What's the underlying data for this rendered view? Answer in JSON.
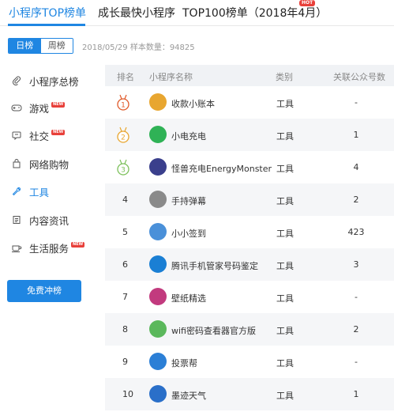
{
  "tabs": [
    {
      "label": "小程序TOP榜单"
    },
    {
      "label": "成长最快小程序"
    },
    {
      "label": "TOP100榜单（2018年4月）",
      "badge": "HOT"
    }
  ],
  "filter": {
    "day": "日榜",
    "week": "周榜",
    "meta": "2018/05/29 样本数量：94825"
  },
  "sidebar": {
    "items": [
      {
        "label": "小程序总榜",
        "icon": "paperclip-icon"
      },
      {
        "label": "游戏",
        "icon": "gamepad-icon",
        "badge": "NEW"
      },
      {
        "label": "社交",
        "icon": "chat-icon",
        "badge": "NEW"
      },
      {
        "label": "网络购物",
        "icon": "shopping-bag-icon"
      },
      {
        "label": "工具",
        "icon": "wrench-icon"
      },
      {
        "label": "内容资讯",
        "icon": "document-icon"
      },
      {
        "label": "生活服务",
        "icon": "coffee-icon",
        "badge": "NEW"
      }
    ],
    "cta": "免费冲榜"
  },
  "table": {
    "headers": [
      "排名",
      "小程序名称",
      "类别",
      "关联公众号数"
    ],
    "rows": [
      {
        "rank": "1",
        "name": "收款小账本",
        "category": "工具",
        "count": "-",
        "icon_color": "#e8a630"
      },
      {
        "rank": "2",
        "name": "小电充电",
        "category": "工具",
        "count": "1",
        "icon_color": "#2fb256"
      },
      {
        "rank": "3",
        "name": "怪兽充电EnergyMonster",
        "category": "工具",
        "count": "4",
        "icon_color": "#3a3f8c"
      },
      {
        "rank": "4",
        "name": "手持弹幕",
        "category": "工具",
        "count": "2",
        "icon_color": "#8a8a8a"
      },
      {
        "rank": "5",
        "name": "小小签到",
        "category": "工具",
        "count": "423",
        "icon_color": "#4a90d9"
      },
      {
        "rank": "6",
        "name": "腾讯手机管家号码鉴定",
        "category": "工具",
        "count": "3",
        "icon_color": "#1a7fd4"
      },
      {
        "rank": "7",
        "name": "壁纸精选",
        "category": "工具",
        "count": "-",
        "icon_color": "#c23a7e"
      },
      {
        "rank": "8",
        "name": "wifi密码查看器官方版",
        "category": "工具",
        "count": "2",
        "icon_color": "#5bb85c"
      },
      {
        "rank": "9",
        "name": "投票帮",
        "category": "工具",
        "count": "-",
        "icon_color": "#2b7fd6"
      },
      {
        "rank": "10",
        "name": "墨迹天气",
        "category": "工具",
        "count": "1",
        "icon_color": "#2a6fc9"
      }
    ]
  },
  "colors": {
    "accent": "#1f86e2",
    "badge": "#e8403a",
    "medal_gold": "#e05a2a",
    "medal_silver": "#e8a630",
    "medal_bronze": "#7cc05a"
  }
}
